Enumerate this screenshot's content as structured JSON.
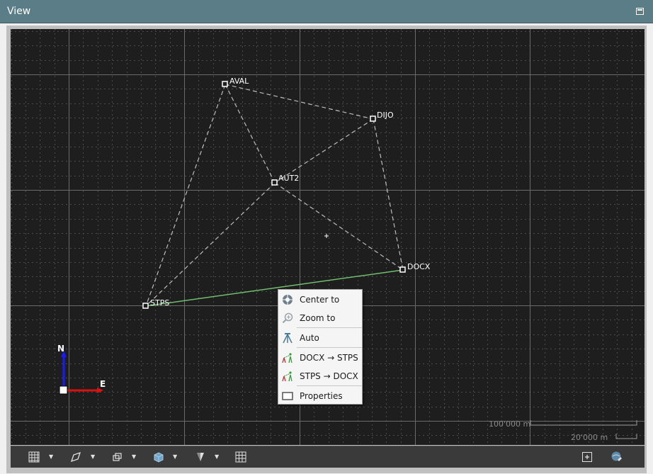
{
  "window": {
    "title": "View"
  },
  "points": [
    {
      "name": "AVAL"
    },
    {
      "name": "DIJO"
    },
    {
      "name": "AUT2"
    },
    {
      "name": "DOCX"
    },
    {
      "name": "STPS"
    }
  ],
  "compass": {
    "north_label": "N",
    "east_label": "E"
  },
  "scale_bars": {
    "large_label": "100'000 m",
    "small_label": "20'000 m"
  },
  "context_menu": {
    "items": [
      {
        "label": "Center to",
        "icon": "center-target-icon"
      },
      {
        "label": "Zoom to",
        "icon": "zoom-in-icon"
      },
      {
        "label": "Auto",
        "icon": "tripod-instrument-icon"
      },
      {
        "label": "DOCX → STPS",
        "icon": "observation-direction-icon"
      },
      {
        "label": "STPS → DOCX",
        "icon": "observation-direction-icon"
      },
      {
        "label": "Properties",
        "icon": "properties-window-icon"
      }
    ]
  },
  "toolbar": {
    "buttons": [
      {
        "icon": "grid-icon",
        "has_dropdown": true
      },
      {
        "icon": "shape-outline-icon",
        "has_dropdown": true
      },
      {
        "icon": "layers-icon",
        "has_dropdown": true
      },
      {
        "icon": "cube-icon",
        "has_dropdown": true
      },
      {
        "icon": "brightness-icon",
        "has_dropdown": true
      },
      {
        "icon": "table-grid-icon",
        "has_dropdown": false
      },
      {
        "icon": "add-frame-icon",
        "has_dropdown": false
      },
      {
        "icon": "globe-sync-icon",
        "has_dropdown": false
      }
    ]
  },
  "colors": {
    "titlebar": "#5b7d88",
    "viewport_background": "#1e1e1e",
    "grid_major": "#6a6a6a",
    "grid_minor": "#4a4a4a",
    "network_line": "#bdbdbd",
    "selected_line": "#6fbf6f",
    "north_arrow": "#1a1aff",
    "east_arrow": "#e01010"
  }
}
